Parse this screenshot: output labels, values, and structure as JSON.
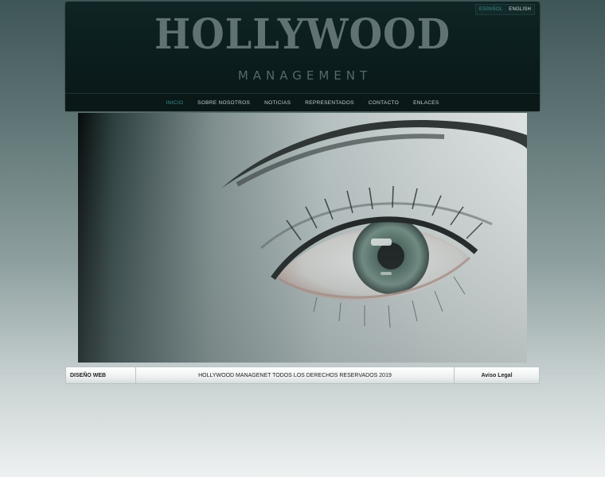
{
  "header": {
    "languages": [
      {
        "label": "ESPAÑOL",
        "active": true
      },
      {
        "label": "ENGLISH",
        "active": false
      }
    ],
    "logo_title": "HOLLYWOOD",
    "logo_subtitle": "MANAGEMENT"
  },
  "nav": {
    "items": [
      {
        "label": "INICIO",
        "active": true
      },
      {
        "label": "SOBRE NOSOTROS",
        "active": false
      },
      {
        "label": "NOTICIAS",
        "active": false
      },
      {
        "label": "REPRESENTADOS",
        "active": false
      },
      {
        "label": "CONTACTO",
        "active": false
      },
      {
        "label": "ENLACES",
        "active": false
      }
    ]
  },
  "footer": {
    "left": "DISEÑO WEB",
    "center": "HOLLYWOOD MANAGENET TODOS LOS DERECHOS RESERVADOS 2019",
    "right": "Aviso Legal"
  },
  "colors": {
    "accent": "#3b8f8b",
    "header_bg": "#0b1c1c",
    "logo": "#617272"
  }
}
